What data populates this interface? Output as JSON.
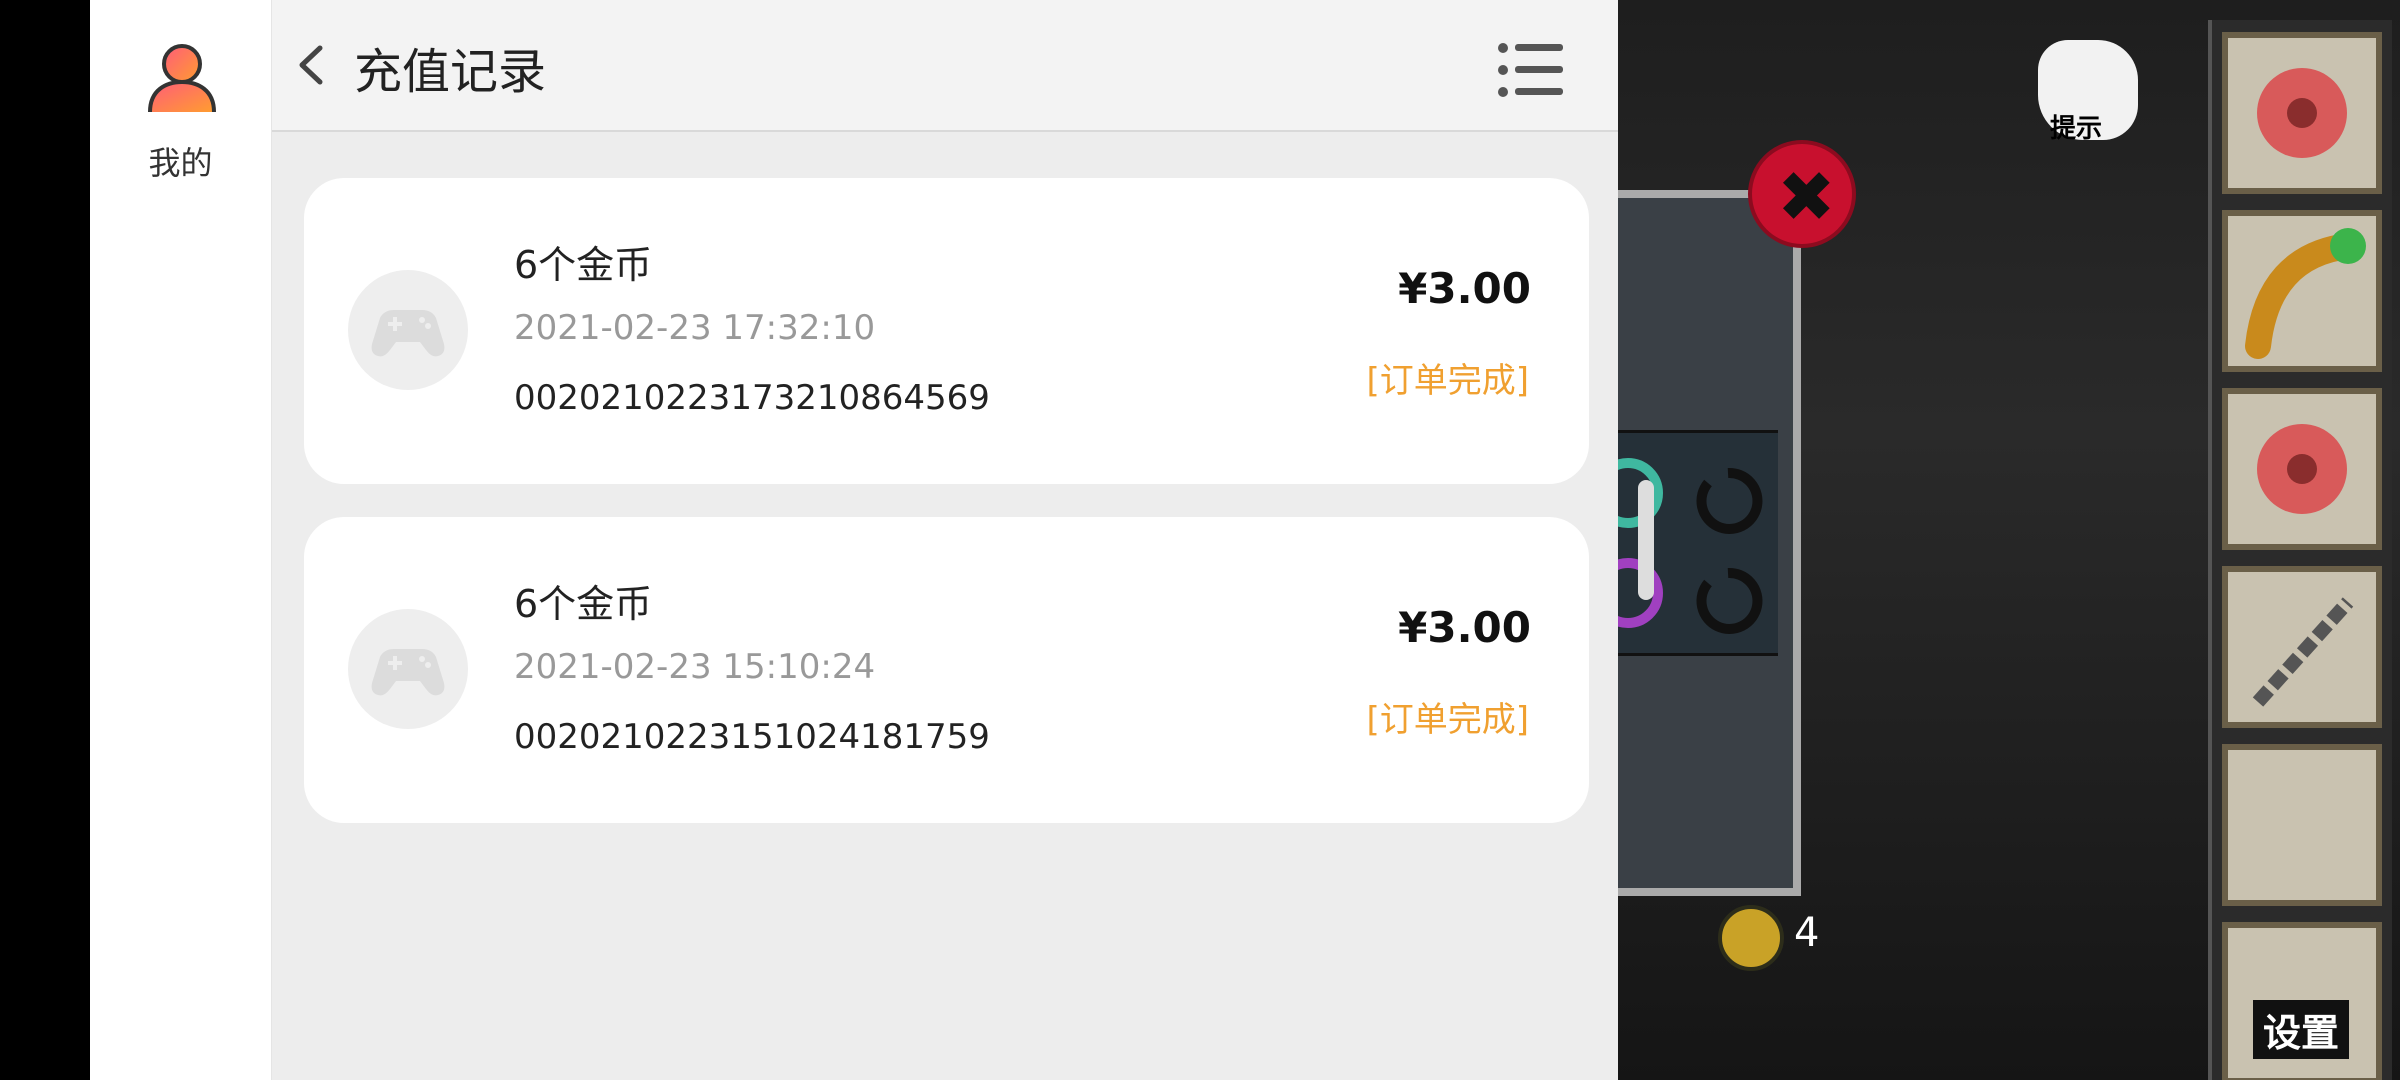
{
  "sidebar": {
    "items": [
      {
        "label": "我的"
      }
    ]
  },
  "header": {
    "title": "充值记录"
  },
  "records": [
    {
      "name": "6个金币",
      "time": "2021-02-23 17:32:10",
      "order_id": "0020210223173210864569",
      "price": "¥3.00",
      "status": "[订单完成]"
    },
    {
      "name": "6个金币",
      "time": "2021-02-23 15:10:24",
      "order_id": "0020210223151024181759",
      "price": "¥3.00",
      "status": "[订单完成]"
    }
  ],
  "game": {
    "hint_label": "提示",
    "coin_count": "4",
    "settings_label": "设置"
  },
  "colors": {
    "accent_status": "#f0a030",
    "panel_bg": "#ededed"
  }
}
